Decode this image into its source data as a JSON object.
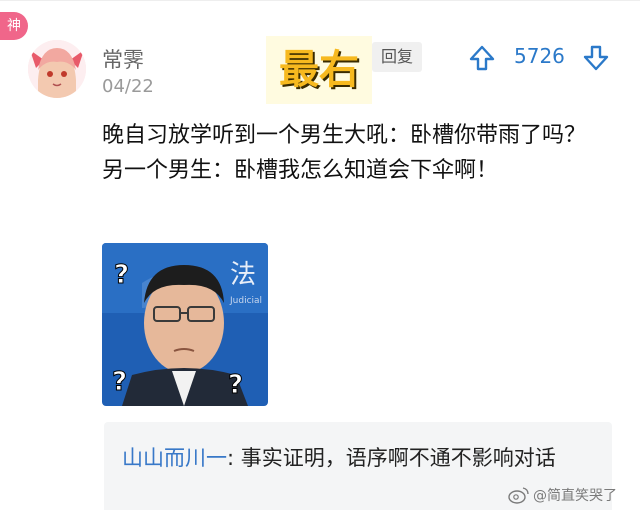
{
  "badge": "神",
  "comment": {
    "username": "常霁",
    "date": "04/22",
    "overlay_label": "最右",
    "reply_label": "回复",
    "vote_count": "5726",
    "text_lines": [
      "晚自习放学听到一个男生大吼：卧槽你带雨了吗？",
      "另一个男生：卧槽我怎么知道会下伞啊！"
    ],
    "meme": {
      "question_mark": "?",
      "backdrop_text": "法",
      "backdrop_small": "Judicial"
    }
  },
  "quote": {
    "author": "山山而川一",
    "separator": ":",
    "text": " 事实证明，语序啊不通不影响对话"
  },
  "watermark": {
    "icon": "weibo-icon",
    "text": "@简直笑哭了"
  },
  "colors": {
    "accent_blue": "#2b79c9",
    "badge_pink": "#f0668a",
    "overlay_yellow": "#f7b91f",
    "quote_bg": "#f4f5f6"
  }
}
